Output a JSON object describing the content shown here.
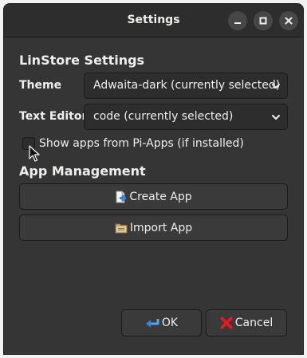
{
  "window": {
    "title": "Settings"
  },
  "settings_section": {
    "title": "LinStore Settings",
    "theme": {
      "label": "Theme",
      "selected": "Adwaita-dark (currently selected)"
    },
    "text_editor": {
      "label": "Text Editor",
      "selected": "code (currently selected)"
    },
    "pi_apps_checkbox": {
      "label": "Show apps from Pi-Apps (if installed)",
      "checked": false
    }
  },
  "app_management": {
    "title": "App Management",
    "create_label": "Create App",
    "import_label": "Import App"
  },
  "dialog_buttons": {
    "ok_label": "OK",
    "cancel_label": "Cancel"
  },
  "icons": {
    "minimize": "minimize-icon",
    "maximize": "maximize-icon",
    "close": "close-icon",
    "create": "new-document-icon",
    "import": "folder-icon",
    "ok": "back-arrow-icon",
    "cancel": "red-x-icon"
  },
  "colors": {
    "window_bg": "#353535",
    "titlebar_bg": "#2d2d2d",
    "text": "#eeeeec",
    "cancel_red": "#e01b24",
    "ok_blue": "#3584e4"
  }
}
